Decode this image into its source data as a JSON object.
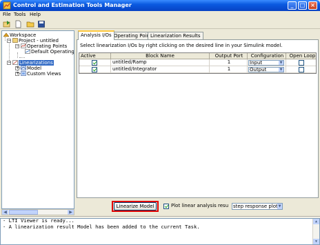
{
  "window": {
    "title": "Control and Estimation Tools Manager",
    "minimize_glyph": "_",
    "maximize_glyph": "□",
    "close_glyph": "×"
  },
  "menu": [
    "File",
    "Tools",
    "Help"
  ],
  "toolbar": {
    "icons": [
      "import-icon",
      "new-task-icon",
      "open-folder-icon",
      "save-icon"
    ]
  },
  "tree": {
    "root": "Workspace",
    "project": "Project - untitled",
    "operating_points": "Operating Points",
    "default_operating_point": "Default Operating Po",
    "linearizations": "Linearizations",
    "model": "Model",
    "custom_views": "Custom Views"
  },
  "tabs": [
    {
      "label": "Analysis I/Os",
      "active": true
    },
    {
      "label": "Operating Points",
      "active": false
    },
    {
      "label": "Linearization Results",
      "active": false
    }
  ],
  "analysis": {
    "instruction": "Select linearization I/Os by right clicking on the desired line in your Simulink model.",
    "columns": [
      "Active",
      "Block Name",
      "Output Port",
      "Configuration",
      "Open Loop"
    ],
    "rows": [
      {
        "active": true,
        "block": "untitled/Ramp",
        "port": "1",
        "config": "Input",
        "open_loop": false
      },
      {
        "active": true,
        "block": "untitled/Integrator",
        "port": "1",
        "config": "Output",
        "open_loop": false
      }
    ]
  },
  "bottom": {
    "linearize_button": "Linearize Model",
    "plot_checkbox_label": "Plot linear analysis result in a",
    "plot_checked": true,
    "plot_type": "step response plot"
  },
  "console": {
    "lines": [
      "- LTI Viewer is ready...",
      "- A linearization result Model has been added to the current Task."
    ]
  },
  "colors": {
    "titlebar": "#0a5ae0",
    "selection": "#316ac5",
    "highlight_frame": "#e00000"
  }
}
